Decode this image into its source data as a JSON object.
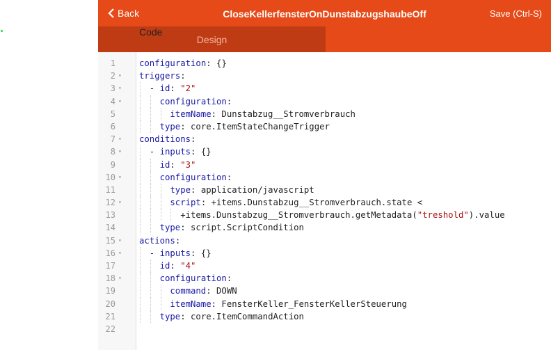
{
  "header": {
    "back_label": "Back",
    "title": "CloseKellerfensterOnDunstabzugshaubeOff",
    "save_label": "Save (Ctrl-S)"
  },
  "tabs": [
    {
      "label": "Design",
      "active": false
    },
    {
      "label": "Code",
      "active": true
    }
  ],
  "colors": {
    "accent": "#e64a19",
    "tab_inactive": "#bf3b14",
    "key": "#1a1aa6",
    "string": "#aa1111"
  },
  "editor": {
    "lines": [
      {
        "n": "1",
        "fold": false,
        "indent": 0,
        "tokens": [
          [
            "k",
            "configuration"
          ],
          [
            "p",
            ": {}"
          ]
        ]
      },
      {
        "n": "2",
        "fold": true,
        "indent": 0,
        "tokens": [
          [
            "k",
            "triggers"
          ],
          [
            "p",
            ":"
          ]
        ]
      },
      {
        "n": "3",
        "fold": true,
        "indent": 1,
        "tokens": [
          [
            "p",
            "- "
          ],
          [
            "k",
            "id"
          ],
          [
            "p",
            ": "
          ],
          [
            "s",
            "\"2\""
          ]
        ]
      },
      {
        "n": "4",
        "fold": true,
        "indent": 2,
        "tokens": [
          [
            "k",
            "configuration"
          ],
          [
            "p",
            ":"
          ]
        ]
      },
      {
        "n": "5",
        "fold": false,
        "indent": 3,
        "tokens": [
          [
            "k",
            "itemName"
          ],
          [
            "p",
            ": Dunstabzug__Stromverbrauch"
          ]
        ]
      },
      {
        "n": "6",
        "fold": false,
        "indent": 2,
        "tokens": [
          [
            "k",
            "type"
          ],
          [
            "p",
            ": core.ItemStateChangeTrigger"
          ]
        ]
      },
      {
        "n": "7",
        "fold": true,
        "indent": 0,
        "tokens": [
          [
            "k",
            "conditions"
          ],
          [
            "p",
            ":"
          ]
        ]
      },
      {
        "n": "8",
        "fold": true,
        "indent": 1,
        "tokens": [
          [
            "p",
            "- "
          ],
          [
            "k",
            "inputs"
          ],
          [
            "p",
            ": {}"
          ]
        ]
      },
      {
        "n": "9",
        "fold": false,
        "indent": 2,
        "tokens": [
          [
            "k",
            "id"
          ],
          [
            "p",
            ": "
          ],
          [
            "s",
            "\"3\""
          ]
        ]
      },
      {
        "n": "10",
        "fold": true,
        "indent": 2,
        "tokens": [
          [
            "k",
            "configuration"
          ],
          [
            "p",
            ":"
          ]
        ]
      },
      {
        "n": "11",
        "fold": false,
        "indent": 3,
        "tokens": [
          [
            "k",
            "type"
          ],
          [
            "p",
            ": application/javascript"
          ]
        ]
      },
      {
        "n": "12",
        "fold": true,
        "indent": 3,
        "tokens": [
          [
            "k",
            "script"
          ],
          [
            "p",
            ": +items.Dunstabzug__Stromverbrauch.state <"
          ]
        ]
      },
      {
        "n": "13",
        "fold": false,
        "indent": 4,
        "tokens": [
          [
            "p",
            "+items.Dunstabzug__Stromverbrauch.getMetadata("
          ],
          [
            "s",
            "\"treshold\""
          ],
          [
            "p",
            ").value"
          ]
        ]
      },
      {
        "n": "14",
        "fold": false,
        "indent": 2,
        "tokens": [
          [
            "k",
            "type"
          ],
          [
            "p",
            ": script.ScriptCondition"
          ]
        ]
      },
      {
        "n": "15",
        "fold": true,
        "indent": 0,
        "tokens": [
          [
            "k",
            "actions"
          ],
          [
            "p",
            ":"
          ]
        ]
      },
      {
        "n": "16",
        "fold": true,
        "indent": 1,
        "tokens": [
          [
            "p",
            "- "
          ],
          [
            "k",
            "inputs"
          ],
          [
            "p",
            ": {}"
          ]
        ]
      },
      {
        "n": "17",
        "fold": false,
        "indent": 2,
        "tokens": [
          [
            "k",
            "id"
          ],
          [
            "p",
            ": "
          ],
          [
            "s",
            "\"4\""
          ]
        ]
      },
      {
        "n": "18",
        "fold": true,
        "indent": 2,
        "tokens": [
          [
            "k",
            "configuration"
          ],
          [
            "p",
            ":"
          ]
        ]
      },
      {
        "n": "19",
        "fold": false,
        "indent": 3,
        "tokens": [
          [
            "k",
            "command"
          ],
          [
            "p",
            ": DOWN"
          ]
        ]
      },
      {
        "n": "20",
        "fold": false,
        "indent": 3,
        "tokens": [
          [
            "k",
            "itemName"
          ],
          [
            "p",
            ": FensterKeller_FensterKellerSteuerung"
          ]
        ]
      },
      {
        "n": "21",
        "fold": false,
        "indent": 2,
        "tokens": [
          [
            "k",
            "type"
          ],
          [
            "p",
            ": core.ItemCommandAction"
          ]
        ]
      },
      {
        "n": "22",
        "fold": false,
        "indent": 0,
        "tokens": []
      }
    ]
  }
}
